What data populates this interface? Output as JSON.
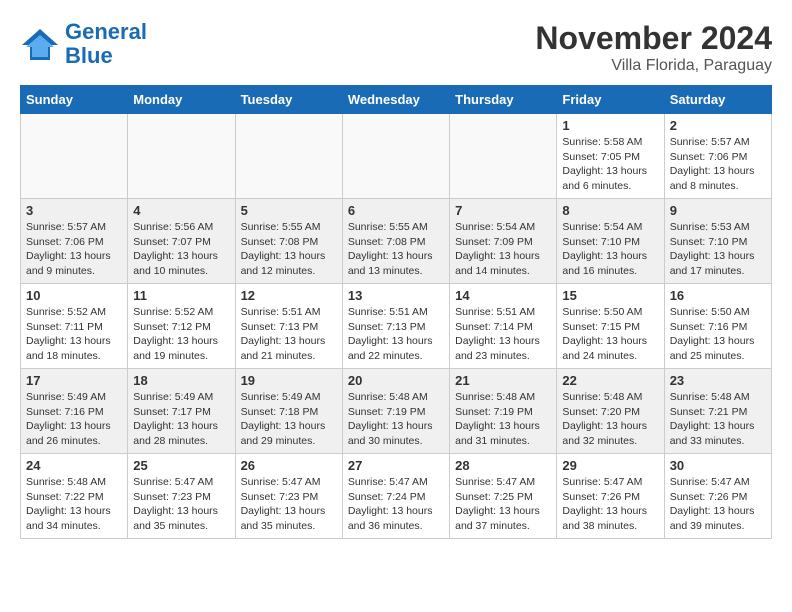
{
  "header": {
    "logo_line1": "General",
    "logo_line2": "Blue",
    "month": "November 2024",
    "location": "Villa Florida, Paraguay"
  },
  "weekdays": [
    "Sunday",
    "Monday",
    "Tuesday",
    "Wednesday",
    "Thursday",
    "Friday",
    "Saturday"
  ],
  "weeks": [
    [
      {
        "day": "",
        "info": ""
      },
      {
        "day": "",
        "info": ""
      },
      {
        "day": "",
        "info": ""
      },
      {
        "day": "",
        "info": ""
      },
      {
        "day": "",
        "info": ""
      },
      {
        "day": "1",
        "info": "Sunrise: 5:58 AM\nSunset: 7:05 PM\nDaylight: 13 hours\nand 6 minutes."
      },
      {
        "day": "2",
        "info": "Sunrise: 5:57 AM\nSunset: 7:06 PM\nDaylight: 13 hours\nand 8 minutes."
      }
    ],
    [
      {
        "day": "3",
        "info": "Sunrise: 5:57 AM\nSunset: 7:06 PM\nDaylight: 13 hours\nand 9 minutes."
      },
      {
        "day": "4",
        "info": "Sunrise: 5:56 AM\nSunset: 7:07 PM\nDaylight: 13 hours\nand 10 minutes."
      },
      {
        "day": "5",
        "info": "Sunrise: 5:55 AM\nSunset: 7:08 PM\nDaylight: 13 hours\nand 12 minutes."
      },
      {
        "day": "6",
        "info": "Sunrise: 5:55 AM\nSunset: 7:08 PM\nDaylight: 13 hours\nand 13 minutes."
      },
      {
        "day": "7",
        "info": "Sunrise: 5:54 AM\nSunset: 7:09 PM\nDaylight: 13 hours\nand 14 minutes."
      },
      {
        "day": "8",
        "info": "Sunrise: 5:54 AM\nSunset: 7:10 PM\nDaylight: 13 hours\nand 16 minutes."
      },
      {
        "day": "9",
        "info": "Sunrise: 5:53 AM\nSunset: 7:10 PM\nDaylight: 13 hours\nand 17 minutes."
      }
    ],
    [
      {
        "day": "10",
        "info": "Sunrise: 5:52 AM\nSunset: 7:11 PM\nDaylight: 13 hours\nand 18 minutes."
      },
      {
        "day": "11",
        "info": "Sunrise: 5:52 AM\nSunset: 7:12 PM\nDaylight: 13 hours\nand 19 minutes."
      },
      {
        "day": "12",
        "info": "Sunrise: 5:51 AM\nSunset: 7:13 PM\nDaylight: 13 hours\nand 21 minutes."
      },
      {
        "day": "13",
        "info": "Sunrise: 5:51 AM\nSunset: 7:13 PM\nDaylight: 13 hours\nand 22 minutes."
      },
      {
        "day": "14",
        "info": "Sunrise: 5:51 AM\nSunset: 7:14 PM\nDaylight: 13 hours\nand 23 minutes."
      },
      {
        "day": "15",
        "info": "Sunrise: 5:50 AM\nSunset: 7:15 PM\nDaylight: 13 hours\nand 24 minutes."
      },
      {
        "day": "16",
        "info": "Sunrise: 5:50 AM\nSunset: 7:16 PM\nDaylight: 13 hours\nand 25 minutes."
      }
    ],
    [
      {
        "day": "17",
        "info": "Sunrise: 5:49 AM\nSunset: 7:16 PM\nDaylight: 13 hours\nand 26 minutes."
      },
      {
        "day": "18",
        "info": "Sunrise: 5:49 AM\nSunset: 7:17 PM\nDaylight: 13 hours\nand 28 minutes."
      },
      {
        "day": "19",
        "info": "Sunrise: 5:49 AM\nSunset: 7:18 PM\nDaylight: 13 hours\nand 29 minutes."
      },
      {
        "day": "20",
        "info": "Sunrise: 5:48 AM\nSunset: 7:19 PM\nDaylight: 13 hours\nand 30 minutes."
      },
      {
        "day": "21",
        "info": "Sunrise: 5:48 AM\nSunset: 7:19 PM\nDaylight: 13 hours\nand 31 minutes."
      },
      {
        "day": "22",
        "info": "Sunrise: 5:48 AM\nSunset: 7:20 PM\nDaylight: 13 hours\nand 32 minutes."
      },
      {
        "day": "23",
        "info": "Sunrise: 5:48 AM\nSunset: 7:21 PM\nDaylight: 13 hours\nand 33 minutes."
      }
    ],
    [
      {
        "day": "24",
        "info": "Sunrise: 5:48 AM\nSunset: 7:22 PM\nDaylight: 13 hours\nand 34 minutes."
      },
      {
        "day": "25",
        "info": "Sunrise: 5:47 AM\nSunset: 7:23 PM\nDaylight: 13 hours\nand 35 minutes."
      },
      {
        "day": "26",
        "info": "Sunrise: 5:47 AM\nSunset: 7:23 PM\nDaylight: 13 hours\nand 35 minutes."
      },
      {
        "day": "27",
        "info": "Sunrise: 5:47 AM\nSunset: 7:24 PM\nDaylight: 13 hours\nand 36 minutes."
      },
      {
        "day": "28",
        "info": "Sunrise: 5:47 AM\nSunset: 7:25 PM\nDaylight: 13 hours\nand 37 minutes."
      },
      {
        "day": "29",
        "info": "Sunrise: 5:47 AM\nSunset: 7:26 PM\nDaylight: 13 hours\nand 38 minutes."
      },
      {
        "day": "30",
        "info": "Sunrise: 5:47 AM\nSunset: 7:26 PM\nDaylight: 13 hours\nand 39 minutes."
      }
    ]
  ]
}
